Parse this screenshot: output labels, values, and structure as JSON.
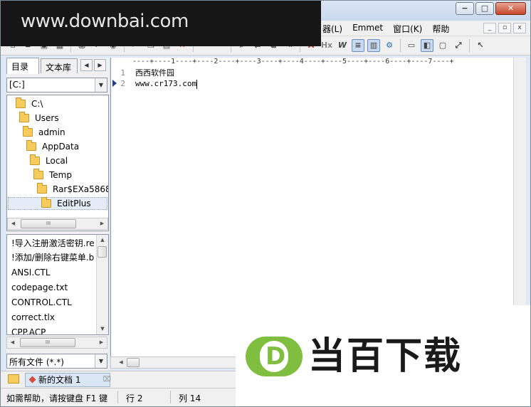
{
  "window": {
    "minimize_glyph": "−",
    "maximize_glyph": "□",
    "close_glyph": "✕"
  },
  "watermark": {
    "text": "www.downbai.com"
  },
  "menubar": {
    "items": [
      "器(L)",
      "Emmet",
      "窗口(K)",
      "帮助"
    ],
    "mdi": [
      "_",
      "▫",
      "x"
    ]
  },
  "left_panel": {
    "tabs": [
      "目录",
      "文本库"
    ],
    "drive": "[C:]",
    "tree": [
      "C:\\",
      "Users",
      "admin",
      "AppData",
      "Local",
      "Temp",
      "Rar$EXa5868",
      "EditPlus"
    ],
    "files": [
      "!导入注册激活密钥.re",
      "!添加/删除右键菜单.b",
      "ANSI.CTL",
      "codepage.txt",
      "CONTROL.CTL",
      "correct.tlx",
      "CPP.ACP"
    ],
    "filter": "所有文件 (*.*)",
    "scroll_thumb": "III"
  },
  "editor": {
    "ruler": "----+----1----+----2----+----3----+----4----+----5----+----6----+----7----+",
    "line_numbers": [
      "1",
      "2"
    ],
    "lines": [
      "西西软件园",
      "www.cr173.com"
    ]
  },
  "doc_tab": {
    "label": "新的文档 1",
    "close": "⌧"
  },
  "status": {
    "help": "如需帮助，请按键盘 F1 键",
    "row": "行 2",
    "col": "列 14"
  },
  "logo": {
    "letter": "D",
    "text": "当百下载",
    "color": "#7fbe3e"
  }
}
